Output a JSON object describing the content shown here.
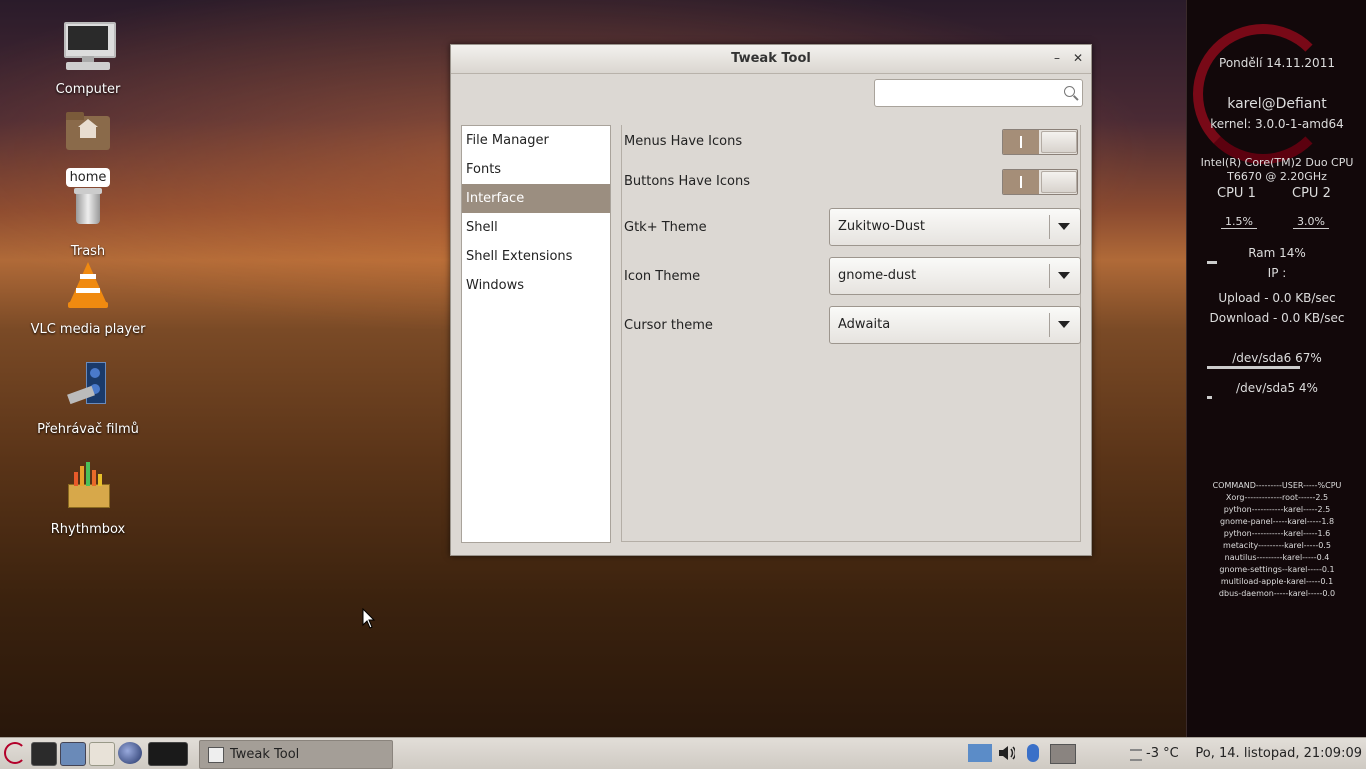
{
  "desktop": {
    "icons": [
      {
        "label": "Computer"
      },
      {
        "label": "home"
      },
      {
        "label": "Trash"
      },
      {
        "label": "VLC media player"
      },
      {
        "label": "Přehrávač filmů"
      },
      {
        "label": "Rhythmbox"
      }
    ]
  },
  "conky": {
    "date": "Pondělí 14.11.2011",
    "user": "karel@Defiant",
    "kernel": "kernel: 3.0.0-1-amd64",
    "cpu_model_1": "Intel(R) Core(TM)2 Duo CPU",
    "cpu_model_2": "T6670  @ 2.20GHz",
    "cpu1_label": "CPU 1",
    "cpu2_label": "CPU 2",
    "cpu1_value": "1.5%",
    "cpu2_value": "3.0%",
    "ram": "Ram 14%",
    "ram_fraction": 0.14,
    "ip": "IP :",
    "upload": "Upload - 0.0 KB/sec",
    "download": "Download - 0.0 KB/sec",
    "sda6": "/dev/sda6 67%",
    "sda6_fraction": 0.67,
    "sda5": "/dev/sda5 4%",
    "sda5_fraction": 0.04,
    "proc_header": "COMMAND---------USER-----%CPU",
    "processes": [
      "Xorg-------------root------2.5",
      "python-----------karel-----2.5",
      "gnome-panel-----karel-----1.8",
      "python-----------karel-----1.6",
      "metacity---------karel-----0.5",
      "nautilus---------karel-----0.4",
      "gnome-settings--karel-----0.1",
      "multiload-apple-karel-----0.1",
      "dbus-daemon-----karel-----0.0"
    ]
  },
  "window": {
    "title": "Tweak Tool",
    "minimize": "–",
    "close": "✕",
    "search_placeholder": "",
    "sidebar": [
      {
        "label": "File Manager"
      },
      {
        "label": "Fonts"
      },
      {
        "label": "Interface"
      },
      {
        "label": "Shell"
      },
      {
        "label": "Shell Extensions"
      },
      {
        "label": "Windows"
      }
    ],
    "active_item": "Interface",
    "settings": {
      "menus_icons_label": "Menus Have Icons",
      "menus_icons_on": true,
      "buttons_icons_label": "Buttons Have Icons",
      "buttons_icons_on": true,
      "gtk_theme_label": "Gtk+ Theme",
      "gtk_theme_value": "Zukitwo-Dust",
      "icon_theme_label": "Icon Theme",
      "icon_theme_value": "gnome-dust",
      "cursor_theme_label": "Cursor theme",
      "cursor_theme_value": "Adwaita"
    }
  },
  "taskbar": {
    "task_label": "Tweak Tool",
    "temperature": "-3 °C",
    "clock": "Po, 14. listopad, 21:09:09"
  }
}
